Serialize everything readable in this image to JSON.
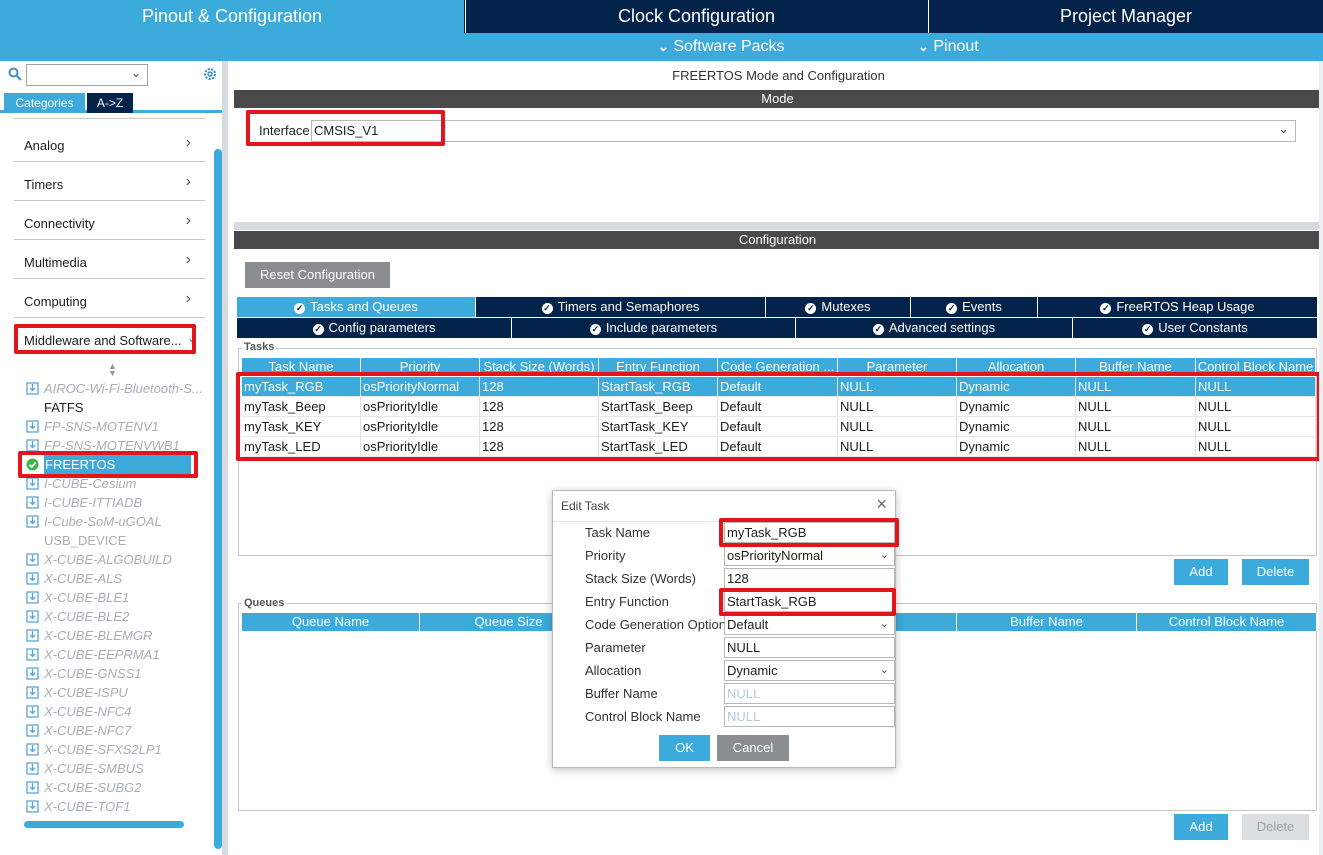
{
  "top_tabs": [
    "Pinout & Configuration",
    "Clock Configuration",
    "Project Manager"
  ],
  "sub_menu": [
    "Software Packs",
    "Pinout"
  ],
  "left": {
    "search_value": "",
    "tabs": [
      "Categories",
      "A->Z"
    ],
    "categories": [
      "Analog",
      "Timers",
      "Connectivity",
      "Multimedia",
      "Computing",
      "Middleware and Software..."
    ],
    "middleware_items": [
      {
        "label": "AIROC-Wi-Fi-Bluetooth-S...",
        "style": "disabled"
      },
      {
        "label": "FATFS",
        "style": "normal"
      },
      {
        "label": "FP-SNS-MOTENV1",
        "style": "disabled"
      },
      {
        "label": "FP-SNS-MOTENVWB1",
        "style": "disabled"
      },
      {
        "label": "FREERTOS",
        "style": "selected"
      },
      {
        "label": "I-CUBE-Cesium",
        "style": "disabled"
      },
      {
        "label": "I-CUBE-ITTIADB",
        "style": "disabled"
      },
      {
        "label": "I-Cube-SoM-uGOAL",
        "style": "disabled"
      },
      {
        "label": "USB_DEVICE",
        "style": "disabled-plain"
      },
      {
        "label": "X-CUBE-ALGOBUILD",
        "style": "disabled"
      },
      {
        "label": "X-CUBE-ALS",
        "style": "disabled"
      },
      {
        "label": "X-CUBE-BLE1",
        "style": "disabled"
      },
      {
        "label": "X-CUBE-BLE2",
        "style": "disabled"
      },
      {
        "label": "X-CUBE-BLEMGR",
        "style": "disabled"
      },
      {
        "label": "X-CUBE-EEPRMA1",
        "style": "disabled"
      },
      {
        "label": "X-CUBE-GNSS1",
        "style": "disabled"
      },
      {
        "label": "X-CUBE-ISPU",
        "style": "disabled"
      },
      {
        "label": "X-CUBE-NFC4",
        "style": "disabled"
      },
      {
        "label": "X-CUBE-NFC7",
        "style": "disabled"
      },
      {
        "label": "X-CUBE-SFXS2LP1",
        "style": "disabled"
      },
      {
        "label": "X-CUBE-SMBUS",
        "style": "disabled"
      },
      {
        "label": "X-CUBE-SUBG2",
        "style": "disabled"
      },
      {
        "label": "X-CUBE-TOF1",
        "style": "disabled"
      }
    ]
  },
  "main": {
    "title": "FREERTOS Mode and Configuration",
    "mode_header": "Mode",
    "interface_label": "Interface",
    "interface_value": "CMSIS_V1",
    "config_header": "Configuration",
    "reset_button": "Reset Configuration",
    "tabs_row1": [
      "Tasks and Queues",
      "Timers and Semaphores",
      "Mutexes",
      "Events",
      "FreeRTOS Heap Usage"
    ],
    "tabs_row2": [
      "Config parameters",
      "Include parameters",
      "Advanced settings",
      "User Constants"
    ],
    "tasks_group": "Tasks",
    "tasks_columns": [
      "Task Name",
      "Priority",
      "Stack Size (Words)",
      "Entry Function",
      "Code Generation ...",
      "Parameter",
      "Allocation",
      "Buffer Name",
      "Control Block Name"
    ],
    "tasks_rows": [
      [
        "myTask_RGB",
        "osPriorityNormal",
        "128",
        "StartTask_RGB",
        "Default",
        "NULL",
        "Dynamic",
        "NULL",
        "NULL"
      ],
      [
        "myTask_Beep",
        "osPriorityIdle",
        "128",
        "StartTask_Beep",
        "Default",
        "NULL",
        "Dynamic",
        "NULL",
        "NULL"
      ],
      [
        "myTask_KEY",
        "osPriorityIdle",
        "128",
        "StartTask_KEY",
        "Default",
        "NULL",
        "Dynamic",
        "NULL",
        "NULL"
      ],
      [
        "myTask_LED",
        "osPriorityIdle",
        "128",
        "StartTask_LED",
        "Default",
        "NULL",
        "Dynamic",
        "NULL",
        "NULL"
      ]
    ],
    "add_button": "Add",
    "delete_button": "Delete",
    "queues_group": "Queues",
    "queues_columns": [
      "Queue Name",
      "Queue Size",
      "",
      "",
      "Buffer Name",
      "Control Block Name"
    ]
  },
  "dialog": {
    "title": "Edit Task",
    "fields": [
      {
        "label": "Task Name",
        "value": "myTask_RGB"
      },
      {
        "label": "Priority",
        "value": "osPriorityNormal"
      },
      {
        "label": "Stack Size (Words)",
        "value": "128"
      },
      {
        "label": "Entry Function",
        "value": "StartTask_RGB"
      },
      {
        "label": "Code Generation Option",
        "value": "Default"
      },
      {
        "label": "Parameter",
        "value": "NULL"
      },
      {
        "label": "Allocation",
        "value": "Dynamic"
      },
      {
        "label": "Buffer Name",
        "value": "NULL"
      },
      {
        "label": "Control Block Name",
        "value": "NULL"
      }
    ],
    "ok": "OK",
    "cancel": "Cancel"
  },
  "colors": {
    "navy": "#03234b",
    "blue": "#3cabdc",
    "highlight_red": "#e3141b"
  }
}
